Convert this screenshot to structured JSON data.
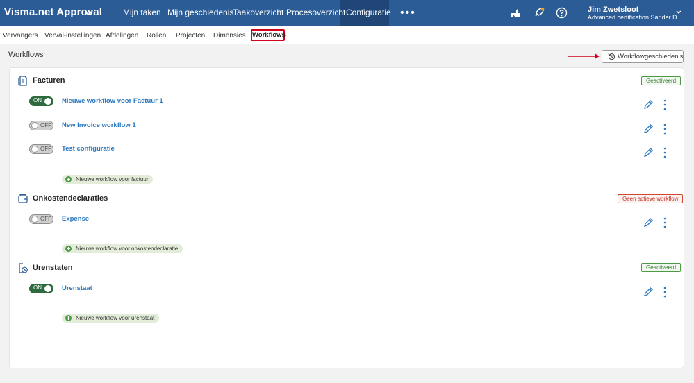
{
  "app": {
    "brand": "Visma.net Approval",
    "nav": [
      "Mijn taken",
      "Mijn geschiedenis",
      "Taakoverzicht",
      "Procesoverzicht",
      "Configuratie"
    ],
    "more": "•••",
    "user_name": "Jim Zwetsloot",
    "user_company": "Advanced certification Sander D..."
  },
  "subnav": [
    "Vervangers",
    "Verval-instellingen",
    "Afdelingen",
    "Rollen",
    "Projecten",
    "Dimensies",
    "Workflows"
  ],
  "page": {
    "title": "Workflows",
    "history_button": "Workflowgeschiedenis"
  },
  "sections": [
    {
      "title": "Facturen",
      "badge": "Geactiveerd",
      "workflows": [
        {
          "state": "ON",
          "name": "Nieuwe workflow voor Factuur 1"
        },
        {
          "state": "OFF",
          "name": "New Invoice workflow 1"
        },
        {
          "state": "OFF",
          "name": "Test configuratie"
        }
      ],
      "add_label": "Nieuwe workflow voor factuur"
    },
    {
      "title": "Onkostendeclaraties",
      "badge": "Geen actieve workflow",
      "workflows": [
        {
          "state": "OFF",
          "name": "Expense"
        }
      ],
      "add_label": "Nieuwe workflow voor onkostendeclaratie"
    },
    {
      "title": "Urenstaten",
      "badge": "Geactiveerd",
      "workflows": [
        {
          "state": "ON",
          "name": "Urenstaat"
        }
      ],
      "add_label": "Nieuwe workflow voor urenstaat"
    }
  ],
  "colors": {
    "topbar": "#2c5c95",
    "active_nav": "#1f4677",
    "link": "#2d7abf",
    "toggle_on": "#2d6a3d",
    "badge_active": "#4c9a46",
    "badge_inactive": "#d0452f",
    "highlight": "#d0021b"
  },
  "icons": [
    "chevron-down-icon",
    "hand-icon",
    "rocket-icon",
    "help-icon",
    "history-icon",
    "invoice-icon",
    "expense-icon",
    "timesheet-icon",
    "edit-pencil-icon",
    "more-vertical-icon",
    "plus-circle-icon",
    "arrow-icon"
  ]
}
